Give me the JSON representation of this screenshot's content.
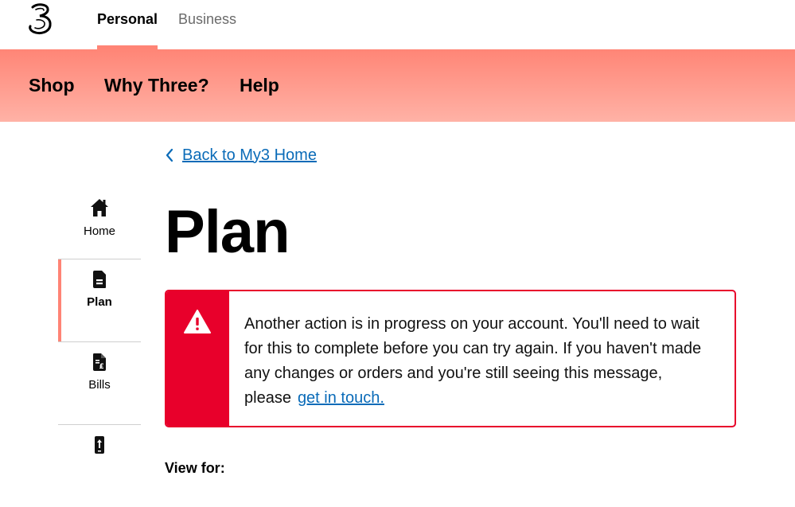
{
  "brand": {
    "logo_icon": "three-logo-icon",
    "accent_color": "#ff8475",
    "alert_color": "#e8002b",
    "link_color": "#0a6bb8"
  },
  "top_tabs": {
    "personal": "Personal",
    "business": "Business"
  },
  "main_nav": {
    "shop": "Shop",
    "why_three": "Why Three?",
    "help": "Help"
  },
  "back_link": {
    "label": "Back to My3 Home",
    "icon": "chevron-left-icon"
  },
  "sidebar": {
    "items": [
      {
        "label": "Home",
        "icon": "home-icon",
        "active": false
      },
      {
        "label": "Plan",
        "icon": "sim-card-icon",
        "active": true
      },
      {
        "label": "Bills",
        "icon": "bill-icon",
        "active": false
      },
      {
        "label": "",
        "icon": "upgrade-phone-icon",
        "active": false
      }
    ]
  },
  "page": {
    "title": "Plan"
  },
  "alert": {
    "icon": "warning-icon",
    "message": "Another action is in progress on your account. You'll need to wait for this to complete before you can try again. If you haven't made any changes or orders and you're still seeing this message, please",
    "link_label": "get in touch."
  },
  "view_for": {
    "label": "View for:"
  }
}
